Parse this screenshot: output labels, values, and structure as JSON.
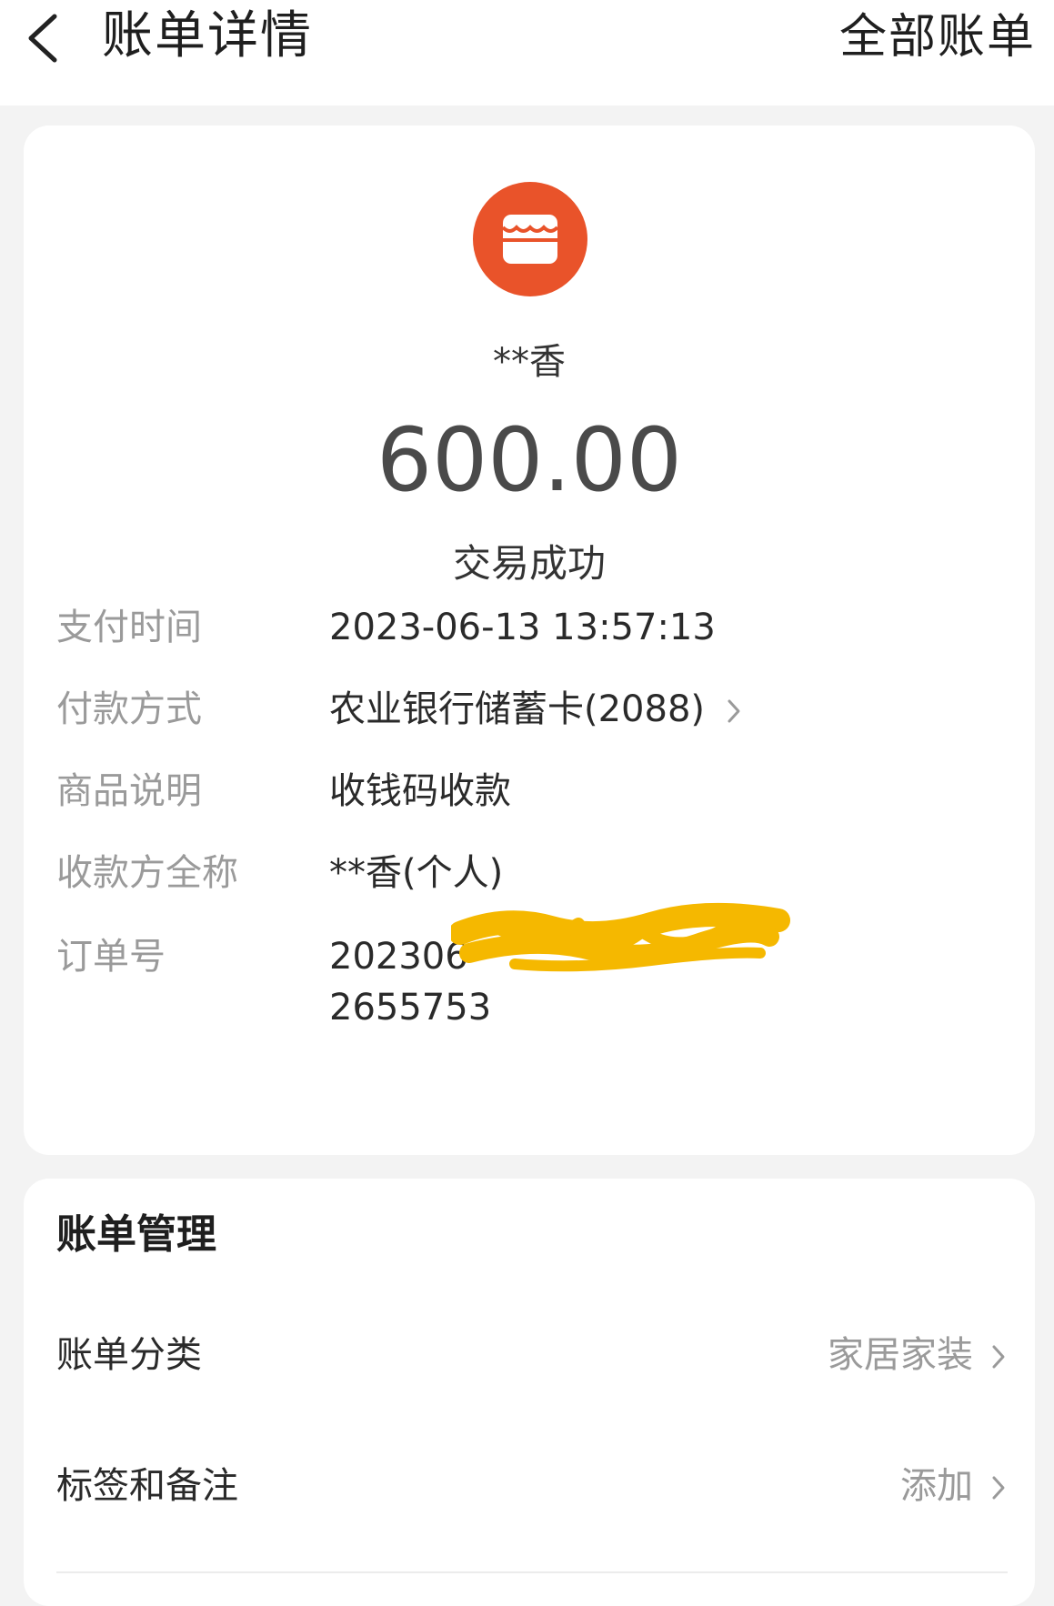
{
  "header": {
    "title": "账单详情",
    "action": "全部账单"
  },
  "transaction": {
    "payee_short": "**香",
    "amount": "600.00",
    "status": "交易成功",
    "avatar_icon": "store-icon",
    "avatar_color": "#e9532a"
  },
  "details": [
    {
      "label": "支付时间",
      "value": "2023-06-13 13:57:13"
    },
    {
      "label": "付款方式",
      "value": "农业银行储蓄卡(2088)"
    },
    {
      "label": "商品说明",
      "value": "收钱码收款"
    },
    {
      "label": "收款方全称",
      "value": "**香(个人)"
    },
    {
      "label": "订单号",
      "value_prefix": "202306",
      "value_suffix": "2655753"
    }
  ],
  "manage": {
    "title": "账单管理",
    "items": [
      {
        "label": "账单分类",
        "value": "家居家装"
      },
      {
        "label": "标签和备注",
        "value": "添加"
      }
    ]
  },
  "colors": {
    "redaction": "#f5b800"
  }
}
